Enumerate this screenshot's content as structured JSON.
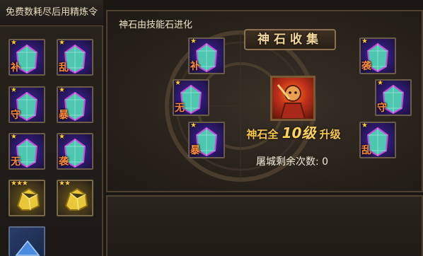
{
  "left_panel": {
    "title": "免费数耗尽后用精炼令",
    "items": [
      {
        "type": "gem",
        "label": "补",
        "stars": "★"
      },
      {
        "type": "gem",
        "label": "乱",
        "stars": "★"
      },
      {
        "type": "gem",
        "label": "守",
        "stars": "★"
      },
      {
        "type": "gem",
        "label": "暴",
        "stars": "★"
      },
      {
        "type": "gem",
        "label": "无",
        "stars": "★"
      },
      {
        "type": "gem",
        "label": "袭",
        "stars": "★"
      },
      {
        "type": "gold",
        "stars": "★★★"
      },
      {
        "type": "gold",
        "stars": "★★"
      },
      {
        "type": "blue"
      }
    ]
  },
  "main": {
    "subtitle": "神石由技能石进化",
    "banner": "神石收集",
    "gems": [
      {
        "label": "补",
        "stars": "★"
      },
      {
        "label": "袭",
        "stars": "★"
      },
      {
        "label": "无",
        "stars": "★"
      },
      {
        "label": "守",
        "stars": "★"
      },
      {
        "label": "暴",
        "stars": "★"
      },
      {
        "label": "乱",
        "stars": "★"
      }
    ],
    "upgrade": {
      "prefix": "神石全",
      "level": "10级",
      "suffix": "升级"
    },
    "remaining": "屠城剩余次数: 0"
  },
  "colors": {
    "accent": "#f7c64a",
    "gem_label": "#ff8a3a",
    "frame": "#6a5c48"
  }
}
